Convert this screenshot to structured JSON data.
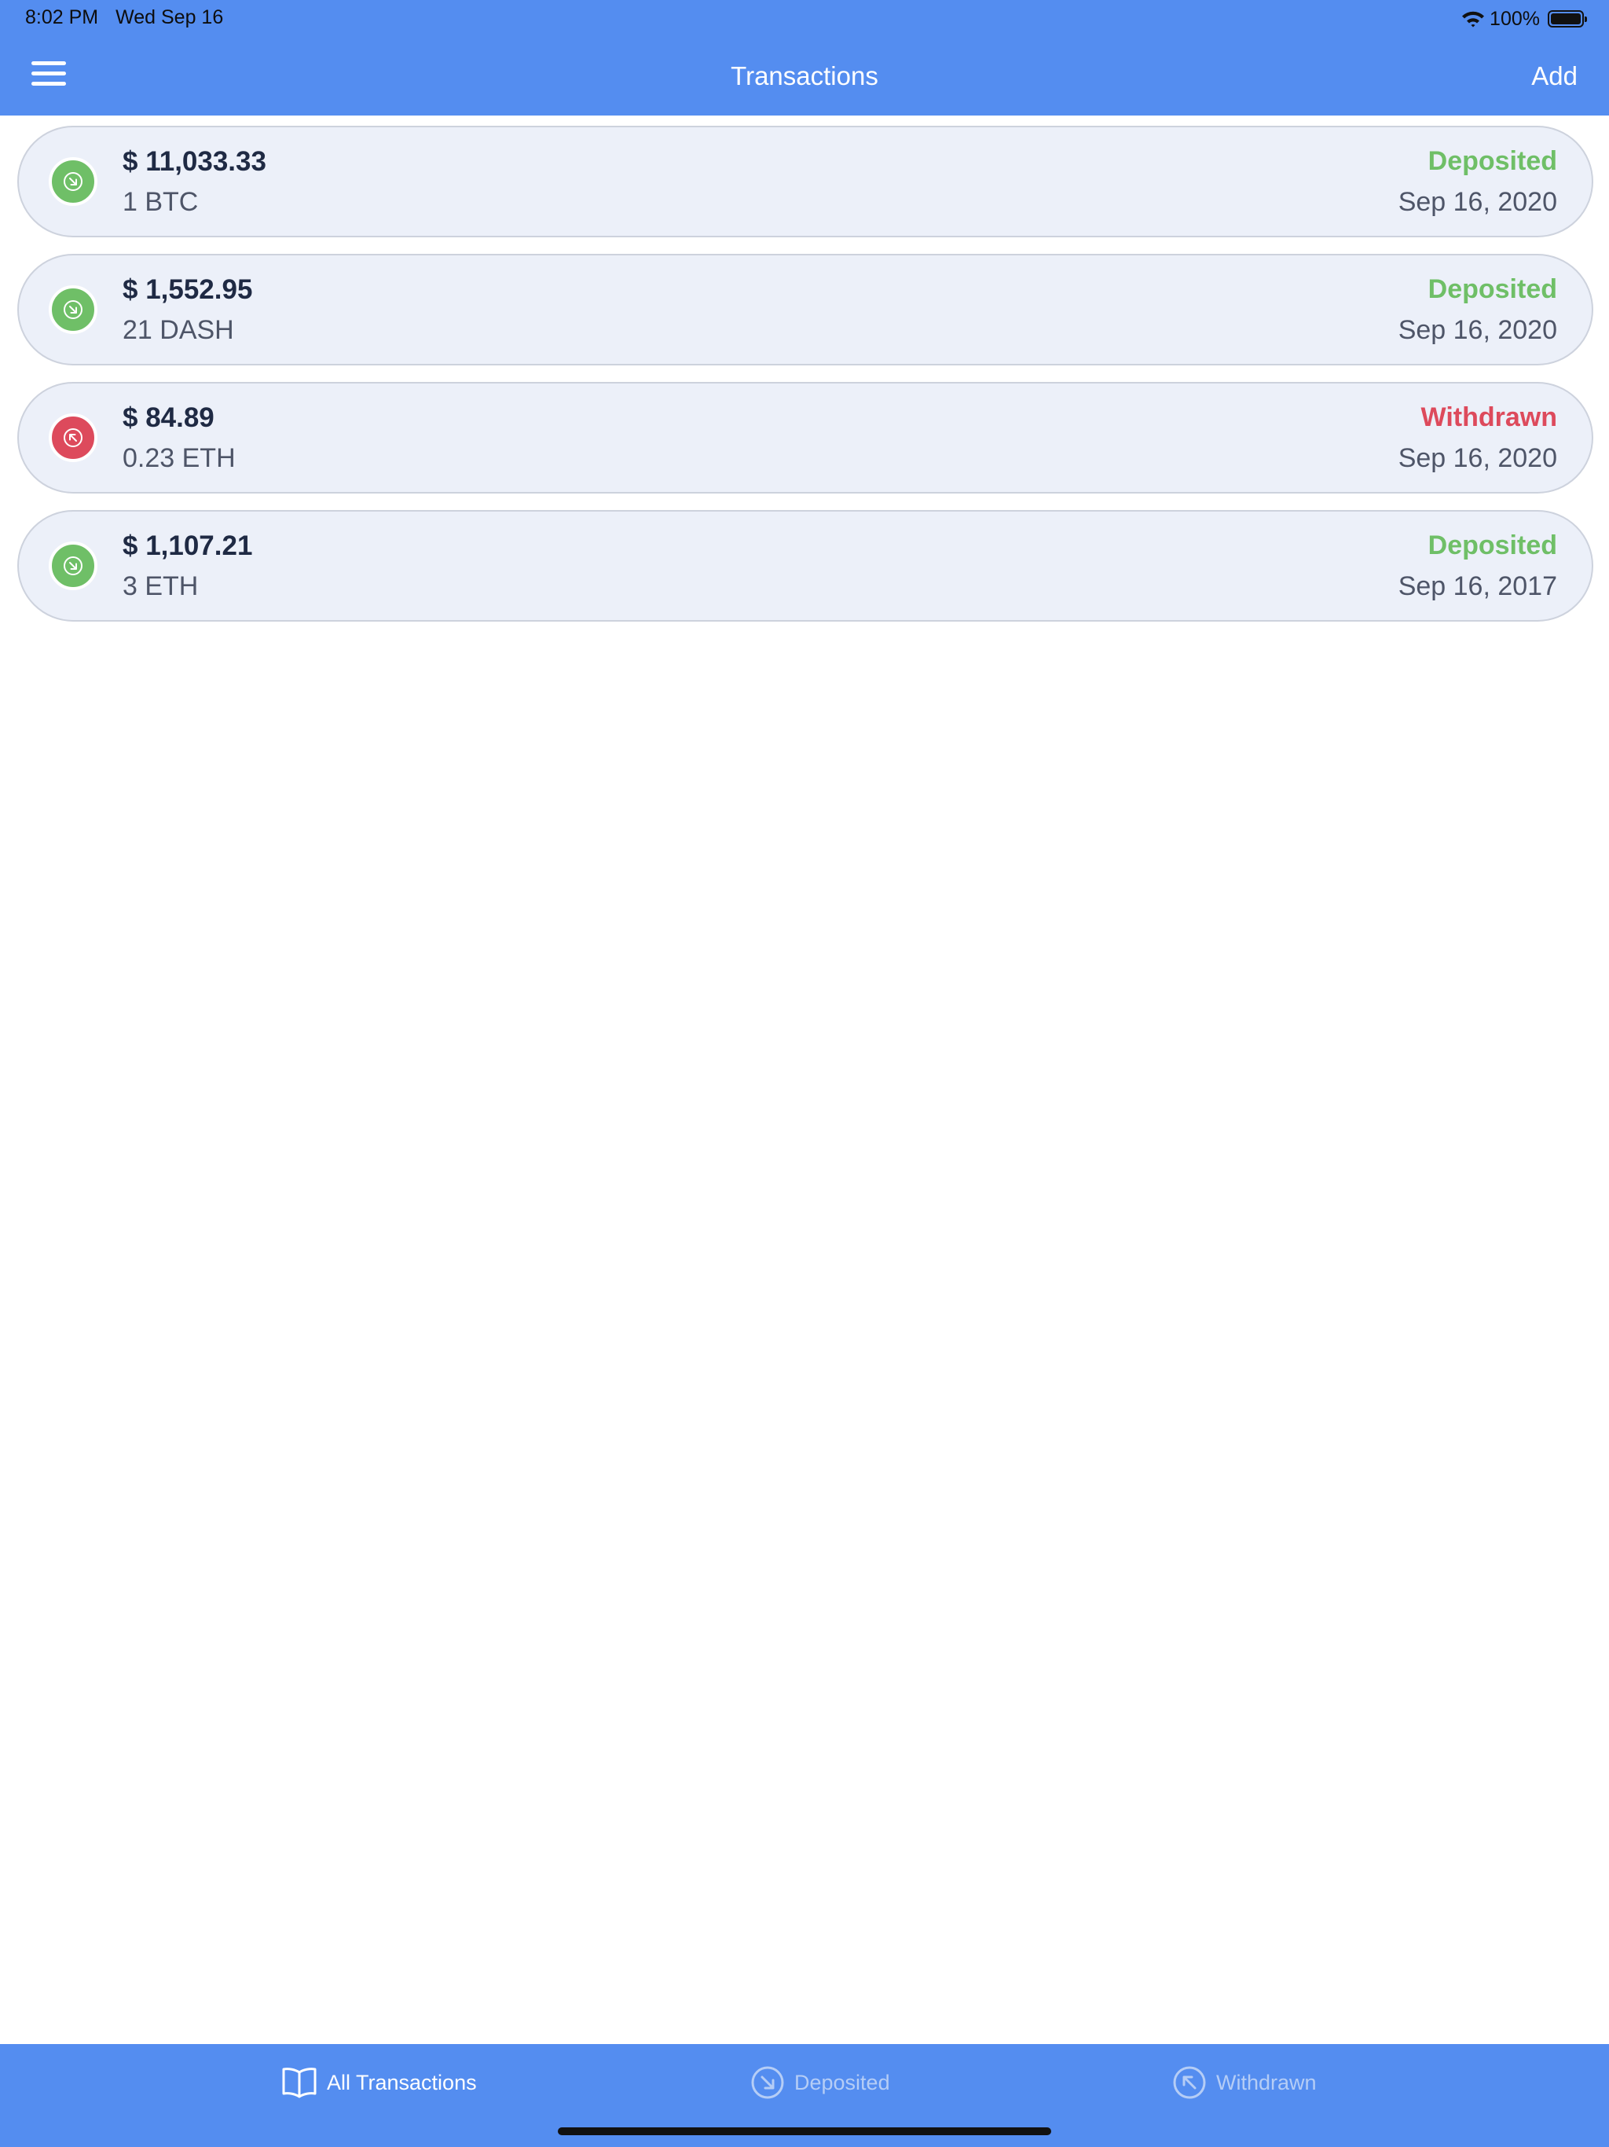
{
  "status_bar": {
    "time": "8:02 PM",
    "date": "Wed Sep 16",
    "battery": "100%"
  },
  "header": {
    "title": "Transactions",
    "add_label": "Add"
  },
  "transactions": [
    {
      "amount": "$ 11,033.33",
      "quantity": "1 BTC",
      "status": "Deposited",
      "date": "Sep 16, 2020",
      "kind": "deposit"
    },
    {
      "amount": "$ 1,552.95",
      "quantity": "21 DASH",
      "status": "Deposited",
      "date": "Sep 16, 2020",
      "kind": "deposit"
    },
    {
      "amount": "$ 84.89",
      "quantity": "0.23 ETH",
      "status": "Withdrawn",
      "date": "Sep 16, 2020",
      "kind": "withdraw"
    },
    {
      "amount": "$ 1,107.21",
      "quantity": "3 ETH",
      "status": "Deposited",
      "date": "Sep 16, 2017",
      "kind": "deposit"
    }
  ],
  "tabs": [
    {
      "label": "All Transactions",
      "icon": "book-icon",
      "active": true
    },
    {
      "label": "Deposited",
      "icon": "arrow-down-right-circle-icon",
      "active": false
    },
    {
      "label": "Withdrawn",
      "icon": "arrow-up-left-circle-icon",
      "active": false
    }
  ],
  "colors": {
    "accent": "#548df0",
    "deposit": "#6fbf67",
    "withdraw": "#dd4a5c",
    "card_bg": "#ecf0f9"
  }
}
